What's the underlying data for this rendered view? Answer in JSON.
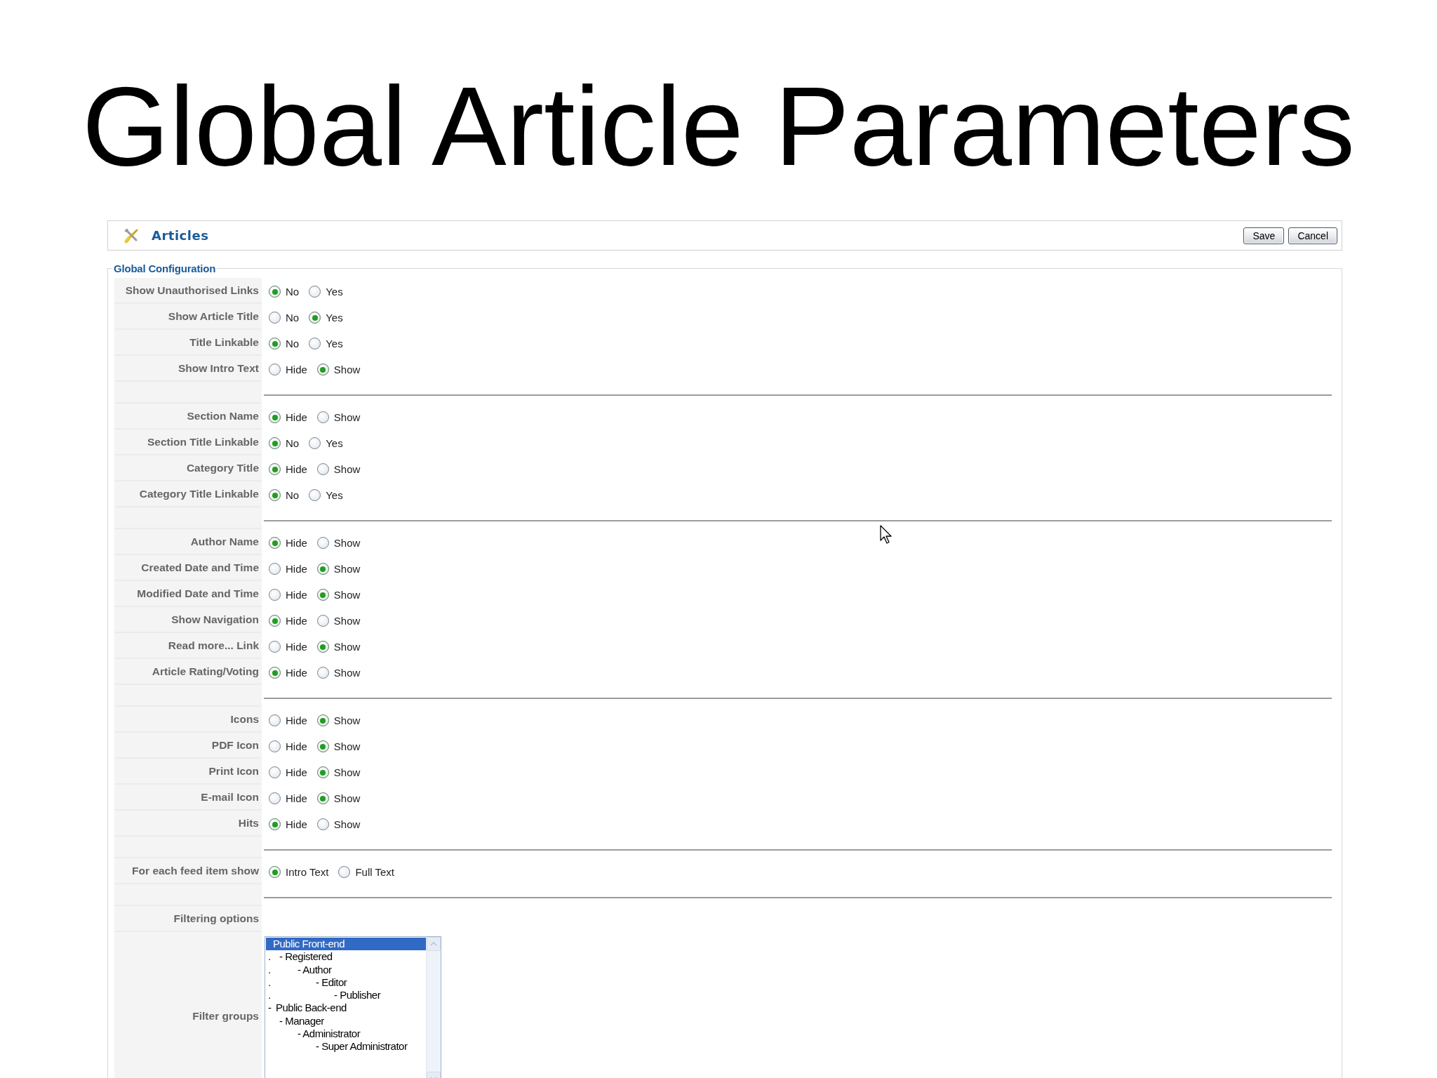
{
  "slide_title": "Global Article Parameters",
  "header": {
    "title": "Articles",
    "buttons": [
      "Save",
      "Cancel"
    ]
  },
  "fieldset": {
    "legend": "Global Configuration",
    "rows": [
      {
        "kind": "radio",
        "label": "Show Unauthorised Links",
        "options": [
          {
            "text": "No",
            "selected": true
          },
          {
            "text": "Yes",
            "selected": false
          }
        ]
      },
      {
        "kind": "radio",
        "label": "Show Article Title",
        "options": [
          {
            "text": "No",
            "selected": false
          },
          {
            "text": "Yes",
            "selected": true
          }
        ]
      },
      {
        "kind": "radio",
        "label": "Title Linkable",
        "options": [
          {
            "text": "No",
            "selected": true
          },
          {
            "text": "Yes",
            "selected": false
          }
        ]
      },
      {
        "kind": "radio",
        "label": "Show Intro Text",
        "options": [
          {
            "text": "Hide",
            "selected": false
          },
          {
            "text": "Show",
            "selected": true
          }
        ]
      },
      {
        "kind": "separator"
      },
      {
        "kind": "radio",
        "label": "Section Name",
        "options": [
          {
            "text": "Hide",
            "selected": true
          },
          {
            "text": "Show",
            "selected": false
          }
        ]
      },
      {
        "kind": "radio",
        "label": "Section Title Linkable",
        "options": [
          {
            "text": "No",
            "selected": true
          },
          {
            "text": "Yes",
            "selected": false
          }
        ]
      },
      {
        "kind": "radio",
        "label": "Category Title",
        "options": [
          {
            "text": "Hide",
            "selected": true
          },
          {
            "text": "Show",
            "selected": false
          }
        ]
      },
      {
        "kind": "radio",
        "label": "Category Title Linkable",
        "options": [
          {
            "text": "No",
            "selected": true
          },
          {
            "text": "Yes",
            "selected": false
          }
        ]
      },
      {
        "kind": "separator"
      },
      {
        "kind": "radio",
        "label": "Author Name",
        "options": [
          {
            "text": "Hide",
            "selected": true
          },
          {
            "text": "Show",
            "selected": false
          }
        ]
      },
      {
        "kind": "radio",
        "label": "Created Date and Time",
        "options": [
          {
            "text": "Hide",
            "selected": false
          },
          {
            "text": "Show",
            "selected": true
          }
        ]
      },
      {
        "kind": "radio",
        "label": "Modified Date and Time",
        "options": [
          {
            "text": "Hide",
            "selected": false
          },
          {
            "text": "Show",
            "selected": true
          }
        ]
      },
      {
        "kind": "radio",
        "label": "Show Navigation",
        "options": [
          {
            "text": "Hide",
            "selected": true
          },
          {
            "text": "Show",
            "selected": false
          }
        ]
      },
      {
        "kind": "radio",
        "label": "Read more... Link",
        "options": [
          {
            "text": "Hide",
            "selected": false
          },
          {
            "text": "Show",
            "selected": true
          }
        ]
      },
      {
        "kind": "radio",
        "label": "Article Rating/Voting",
        "options": [
          {
            "text": "Hide",
            "selected": true
          },
          {
            "text": "Show",
            "selected": false
          }
        ]
      },
      {
        "kind": "separator"
      },
      {
        "kind": "radio",
        "label": "Icons",
        "options": [
          {
            "text": "Hide",
            "selected": false
          },
          {
            "text": "Show",
            "selected": true
          }
        ]
      },
      {
        "kind": "radio",
        "label": "PDF Icon",
        "options": [
          {
            "text": "Hide",
            "selected": false
          },
          {
            "text": "Show",
            "selected": true
          }
        ]
      },
      {
        "kind": "radio",
        "label": "Print Icon",
        "options": [
          {
            "text": "Hide",
            "selected": false
          },
          {
            "text": "Show",
            "selected": true
          }
        ]
      },
      {
        "kind": "radio",
        "label": "E-mail Icon",
        "options": [
          {
            "text": "Hide",
            "selected": false
          },
          {
            "text": "Show",
            "selected": true
          }
        ]
      },
      {
        "kind": "radio",
        "label": "Hits",
        "options": [
          {
            "text": "Hide",
            "selected": true
          },
          {
            "text": "Show",
            "selected": false
          }
        ]
      },
      {
        "kind": "separator"
      },
      {
        "kind": "radio",
        "label": "For each feed item show",
        "options": [
          {
            "text": "Intro Text",
            "selected": true
          },
          {
            "text": "Full Text",
            "selected": false
          }
        ]
      },
      {
        "kind": "separator"
      },
      {
        "kind": "heading",
        "label": "Filtering options"
      },
      {
        "kind": "listbox",
        "label": "Filter groups",
        "items": [
          {
            "text": "Public Front-end",
            "selected": true,
            "children": [
              {
                "prefix": ".",
                "text": "- Registered",
                "selected": false,
                "children": [
                  {
                    "prefix": ".",
                    "text": "- Author",
                    "selected": false,
                    "children": [
                      {
                        "prefix": ".",
                        "text": "- Editor",
                        "selected": false,
                        "children": [
                          {
                            "prefix": ".",
                            "text": "- Publisher",
                            "selected": false
                          }
                        ]
                      }
                    ]
                  }
                ]
              }
            ]
          },
          {
            "prefix": "-",
            "text": "Public Back-end",
            "selected": false,
            "children": [
              {
                "text": "- Manager",
                "selected": false,
                "children": [
                  {
                    "text": "- Administrator",
                    "selected": false,
                    "children": [
                      {
                        "text": "- Super Administrator",
                        "selected": false
                      }
                    ]
                  }
                ]
              }
            ]
          }
        ]
      }
    ]
  }
}
